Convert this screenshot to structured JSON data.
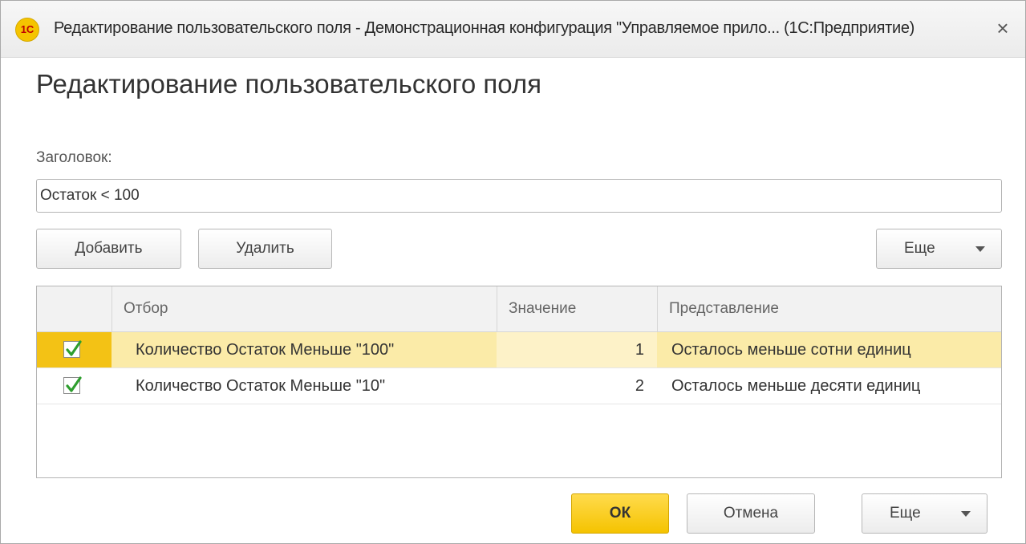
{
  "window": {
    "logo_text": "1С",
    "title": "Редактирование пользовательского поля - Демонстрационная конфигурация \"Управляемое прило... (1С:Предприятие)",
    "close_symbol": "×"
  },
  "form": {
    "heading": "Редактирование пользовательского поля",
    "title_label": "Заголовок:",
    "title_value": "Остаток < 100"
  },
  "toolbar": {
    "add_label": "Добавить",
    "delete_label": "Удалить",
    "more_label": "Еще"
  },
  "table": {
    "columns": {
      "check": "",
      "filter": "Отбор",
      "value": "Значение",
      "view": "Представление"
    },
    "rows": [
      {
        "checked": true,
        "filter": "Количество Остаток Меньше \"100\"",
        "value": "1",
        "view": "Осталось меньше сотни единиц",
        "selected": true
      },
      {
        "checked": true,
        "filter": "Количество Остаток Меньше \"10\"",
        "value": "2",
        "view": "Осталось меньше десяти единиц",
        "selected": false
      }
    ]
  },
  "footer": {
    "ok_label": "ОК",
    "cancel_label": "Отмена",
    "more_label": "Еще"
  },
  "colors": {
    "accent": "#f5c300",
    "selected_row": "#fbeba8",
    "check_mark": "#2e9e2e"
  }
}
